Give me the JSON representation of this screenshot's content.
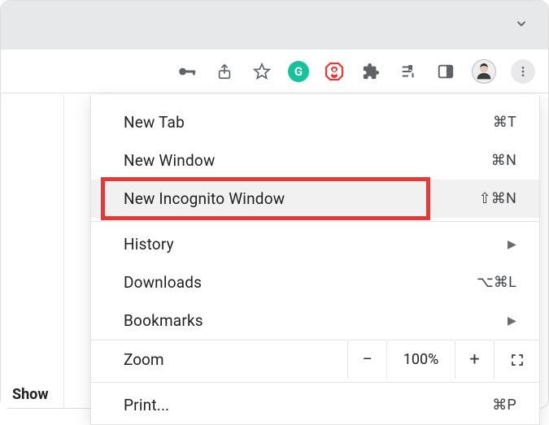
{
  "toolbar": {},
  "menu": {
    "newTab": {
      "label": "New Tab",
      "shortcut": "⌘T"
    },
    "newWindow": {
      "label": "New Window",
      "shortcut": "⌘N"
    },
    "newIncognito": {
      "label": "New Incognito Window",
      "shortcut": "⇧⌘N"
    },
    "history": {
      "label": "History"
    },
    "downloads": {
      "label": "Downloads",
      "shortcut": "⌥⌘L"
    },
    "bookmarks": {
      "label": "Bookmarks"
    },
    "zoom": {
      "label": "Zoom",
      "minus": "−",
      "value": "100%",
      "plus": "+"
    },
    "print": {
      "label": "Print...",
      "shortcut": "⌘P"
    }
  },
  "leftPanel": {
    "showText": "Show"
  },
  "extensions": {
    "grammarlyGlyph": "G"
  }
}
